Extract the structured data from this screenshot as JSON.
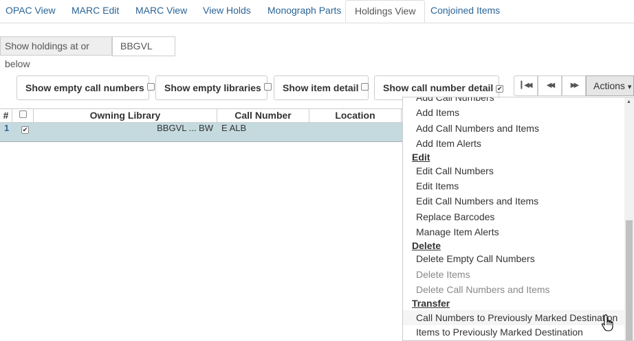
{
  "tabs": [
    {
      "label": "OPAC View"
    },
    {
      "label": "MARC Edit"
    },
    {
      "label": "MARC View"
    },
    {
      "label": "View Holds"
    },
    {
      "label": "Monograph Parts"
    },
    {
      "label": "Holdings View",
      "active": true
    },
    {
      "label": "Conjoined Items"
    }
  ],
  "holdings": {
    "label": "Show holdings at or below",
    "value": "BBGVL"
  },
  "toggles": {
    "empty_call_numbers": {
      "label": "Show empty call numbers",
      "checked": false
    },
    "empty_libraries": {
      "label": "Show empty libraries",
      "checked": false
    },
    "item_detail": {
      "label": "Show item detail",
      "checked": false
    },
    "call_number_detail": {
      "label": "Show call number detail",
      "checked": true
    }
  },
  "pager": {
    "first_icon": "first-page-icon",
    "prev_icon": "previous-page-icon",
    "next_icon": "next-page-icon"
  },
  "actions": {
    "label": "Actions",
    "caret": "▾"
  },
  "grid": {
    "columns": {
      "num": "#",
      "owning_library": "Owning Library",
      "call_number": "Call Number",
      "location": "Location"
    },
    "rows": [
      {
        "num": "1",
        "owning_library": "BBGVL ... BW",
        "call_number": "E ALB",
        "selected": true
      }
    ]
  },
  "menu": {
    "partial_top": "Add Call Numbers",
    "add_items": "Add Items",
    "add_call_numbers_and_items": "Add Call Numbers and Items",
    "add_item_alerts": "Add Item Alerts",
    "edit_header": "Edit",
    "edit_call_numbers": "Edit Call Numbers",
    "edit_items": "Edit Items",
    "edit_call_numbers_and_items": "Edit Call Numbers and Items",
    "replace_barcodes": "Replace Barcodes",
    "manage_item_alerts": "Manage Item Alerts",
    "delete_header": "Delete",
    "delete_empty_call_numbers": "Delete Empty Call Numbers",
    "delete_items": "Delete Items",
    "delete_call_numbers_and_items": "Delete Call Numbers and Items",
    "transfer_header": "Transfer",
    "call_numbers_to_marked": "Call Numbers to Previously Marked Destination",
    "items_to_marked": "Items to Previously Marked Destination"
  }
}
